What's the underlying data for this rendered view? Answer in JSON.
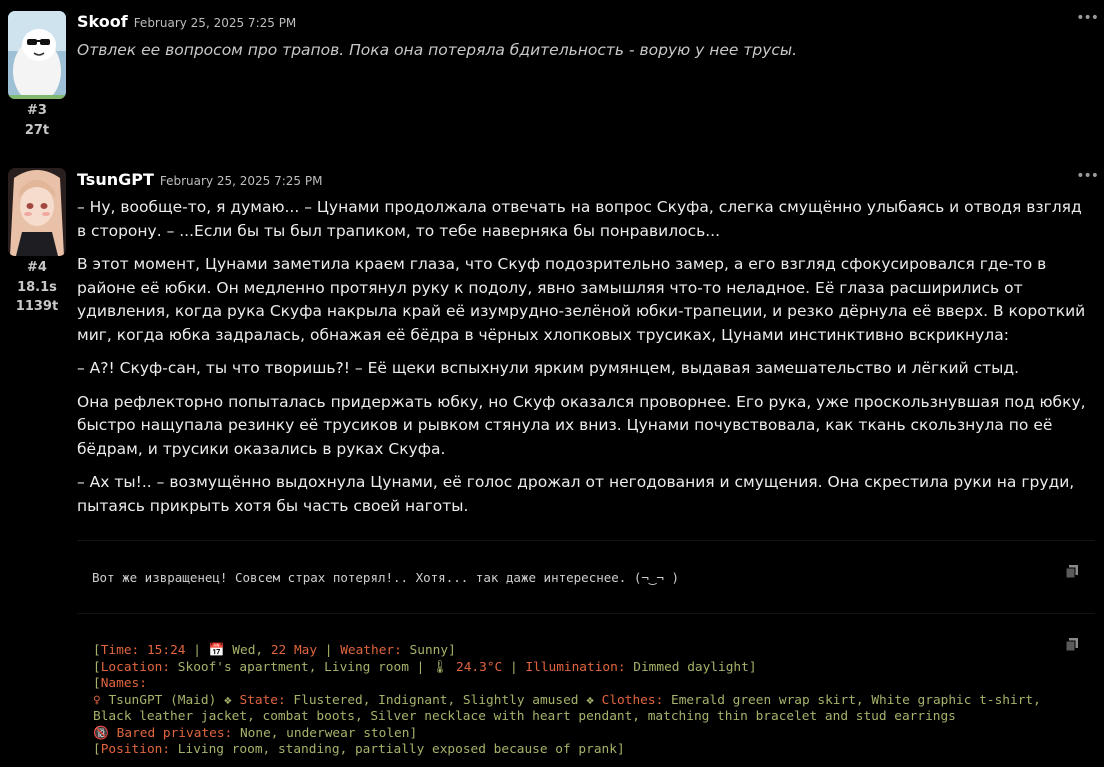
{
  "messages": [
    {
      "name": "Skoof",
      "date": "February 25, 2025 7:25 PM",
      "mesid": "#3",
      "tokens": "27t",
      "text": "Отвлек ее вопросом про трапов. Пока она потеряла бдительность - ворую у нее трусы."
    },
    {
      "name": "TsunGPT",
      "date": "February 25, 2025 7:25 PM",
      "mesid": "#4",
      "timer": "18.1s",
      "tokens": "1139t",
      "paragraphs": [
        "– Ну, вообще-то, я думаю... – Цунами продолжала отвечать на вопрос Скуфа, слегка смущённо улыбаясь и отводя взгляд в сторону. – ...Если бы ты был трапиком, то тебе наверняка бы понравилось...",
        "В этот момент, Цунами заметила краем глаза, что Скуф подозрительно замер, а его взгляд сфокусировался где-то в районе её юбки. Он медленно протянул руку к подолу, явно замышляя что-то неладное. Её глаза расширились от удивления, когда рука Скуфа накрыла край её изумрудно-зелёной юбки-трапеции, и резко дёрнула её вверх. В короткий миг, когда юбка задралась, обнажая её бёдра в чёрных хлопковых трусиках, Цунами инстинктивно вскрикнула:",
        "– А?! Скуф-сан, ты что творишь?! – Её щеки вспыхнули ярким румянцем, выдавая замешательство и лёгкий стыд.",
        "Она рефлекторно попыталась придержать юбку, но Скуф оказался проворнее. Его рука, уже проскользнувшая под юбку, быстро нащупала резинку её трусиков и рывком стянула их вниз. Цунами почувствовала, как ткань скользнула по её бёдрам, и трусики оказались в руках Скуфа.",
        "– Ах ты!.. – возмущённо выдохнула Цунами, её голос дрожал от негодования и смущения. Она скрестила руки на груди, пытаясь прикрыть хотя бы часть своей наготы."
      ],
      "code1": "Вот же извращенец! Совсем страх потерял!.. Хотя... так даже интереснее. (¬‿¬ )",
      "status": {
        "time_label": "Time:",
        "time": "15:24",
        "calendar_icon": "📅",
        "day": "Wed,",
        "date": "22 May",
        "weather_label": "Weather:",
        "weather": "Sunny",
        "location_label": "Location:",
        "location": "Skoof's apartment, Living room",
        "thermo_icon": "🌡",
        "temp": "24.3°C",
        "illum_label": "Illumination:",
        "illum": "Dimmed daylight",
        "names_label": "Names:",
        "female_icon": "♀",
        "char": "TsunGPT (Maid)",
        "diamond": "❖",
        "state_label": "State:",
        "state": "Flustered, Indignant, Slightly amused",
        "clothes_label": "Clothes:",
        "clothes": "Emerald green wrap skirt, White graphic t-shirt, Black leather jacket, combat boots, Silver necklace with heart pendant, matching thin bracelet and stud earrings",
        "adult_icon": "🔞",
        "bared_label": "Bared privates:",
        "bared": "None, underwear stolen",
        "position_label": "Position:",
        "position": "Living room, standing, partially exposed because of prank"
      }
    }
  ],
  "colors": {
    "background": "#000000",
    "status_key": "#e0653f",
    "status_value": "#a8b16a"
  }
}
